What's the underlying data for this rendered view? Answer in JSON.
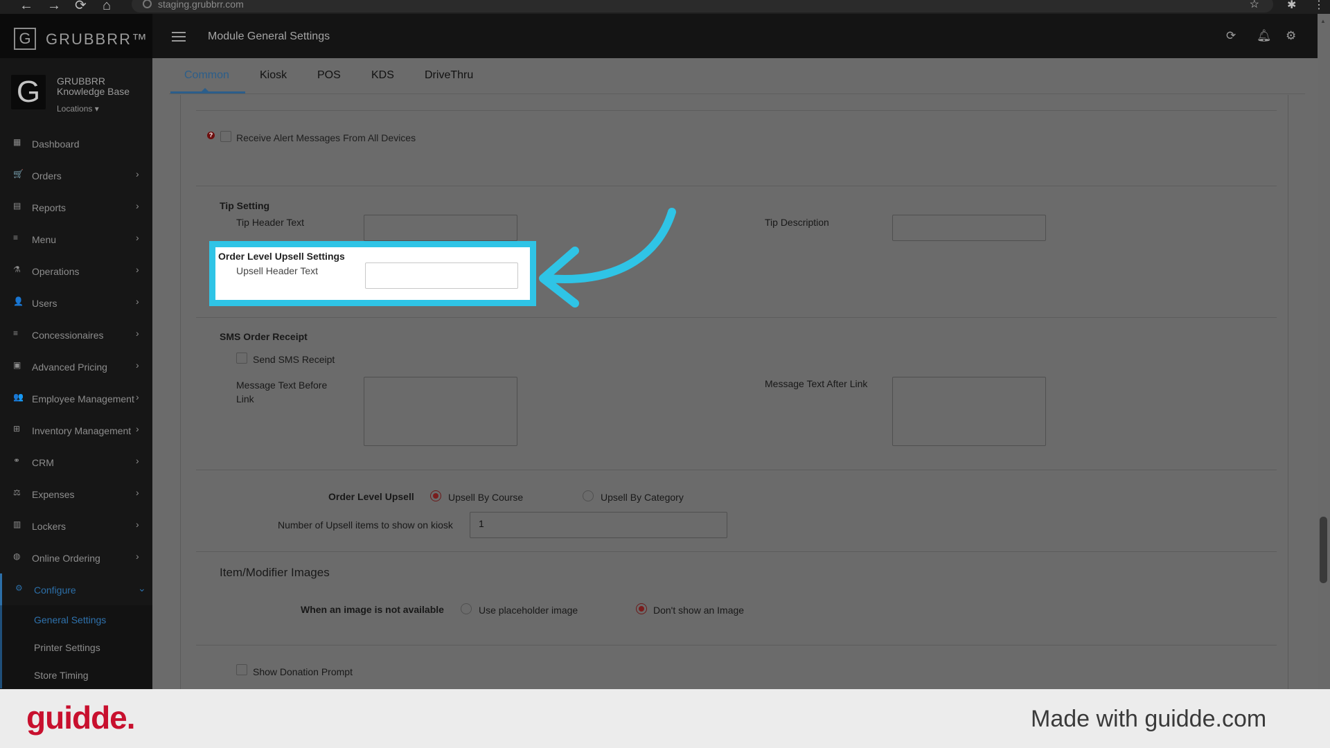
{
  "browser": {
    "url": "staging.grubbrr.com",
    "buttons": [
      "←",
      "→",
      "⟳",
      "⌂"
    ]
  },
  "app": {
    "brand": "GRUBBRR™",
    "page_title": "Module General Settings"
  },
  "profile": {
    "name": "GRUBBRR Knowledge Base",
    "locations_label": "Locations"
  },
  "sidebar": {
    "items": [
      {
        "label": "Dashboard",
        "icon": "dashboard-icon",
        "glyph": "▦"
      },
      {
        "label": "Orders",
        "icon": "cart-icon",
        "glyph": "🛒"
      },
      {
        "label": "Reports",
        "icon": "report-icon",
        "glyph": "▤"
      },
      {
        "label": "Menu",
        "icon": "menu-list-icon",
        "glyph": "≡"
      },
      {
        "label": "Operations",
        "icon": "flask-icon",
        "glyph": "⚗"
      },
      {
        "label": "Users",
        "icon": "users-icon",
        "glyph": "👤"
      },
      {
        "label": "Concessionaires",
        "icon": "list-icon",
        "glyph": "≡"
      },
      {
        "label": "Advanced Pricing",
        "icon": "money-icon",
        "glyph": "▣"
      },
      {
        "label": "Employee Management",
        "icon": "employees-icon",
        "glyph": "👥"
      },
      {
        "label": "Inventory Management",
        "icon": "sitemap-icon",
        "glyph": "⊞"
      },
      {
        "label": "CRM",
        "icon": "link-icon",
        "glyph": "⚭"
      },
      {
        "label": "Expenses",
        "icon": "scale-icon",
        "glyph": "⚖"
      },
      {
        "label": "Lockers",
        "icon": "lockers-icon",
        "glyph": "▥"
      },
      {
        "label": "Online Ordering",
        "icon": "globe-icon",
        "glyph": "◍"
      },
      {
        "label": "Configure",
        "icon": "gear-icon",
        "glyph": "⚙"
      }
    ],
    "sub_items": [
      "General Settings",
      "Printer Settings",
      "Store Timing"
    ]
  },
  "tabs": [
    "Common",
    "Kiosk",
    "POS",
    "KDS",
    "DriveThru"
  ],
  "form": {
    "alert_messages_label": "Receive Alert Messages From All Devices",
    "tip_section_title": "Tip Setting",
    "tip_header_label": "Tip Header Text",
    "tip_header_value": "",
    "tip_description_label": "Tip Description",
    "tip_description_value": "",
    "upsell_section_title": "Order Level Upsell Settings",
    "upsell_header_label": "Upsell Header Text",
    "upsell_header_value": "",
    "sms_section_title": "SMS Order Receipt",
    "send_sms_label": "Send SMS Receipt",
    "msg_before_label": "Message Text Before Link",
    "msg_after_label": "Message Text After Link",
    "order_level_upsell_label": "Order Level Upsell",
    "upsell_by_course_label": "Upsell By Course",
    "upsell_by_category_label": "Upsell By Category",
    "upsell_count_label": "Number of Upsell items to show on kiosk",
    "upsell_count_value": "1",
    "images_section_title": "Item/Modifier Images",
    "no_image_label": "When an image is not available",
    "use_placeholder_label": "Use placeholder image",
    "dont_show_label": "Don't show an Image",
    "donation_label": "Show Donation Prompt"
  },
  "footer": {
    "logo": "guidde.",
    "tagline": "Made with guidde.com"
  },
  "colors": {
    "highlight": "#2fc4e6",
    "accent": "#2c5e8a",
    "brand_red": "#c8102e"
  }
}
